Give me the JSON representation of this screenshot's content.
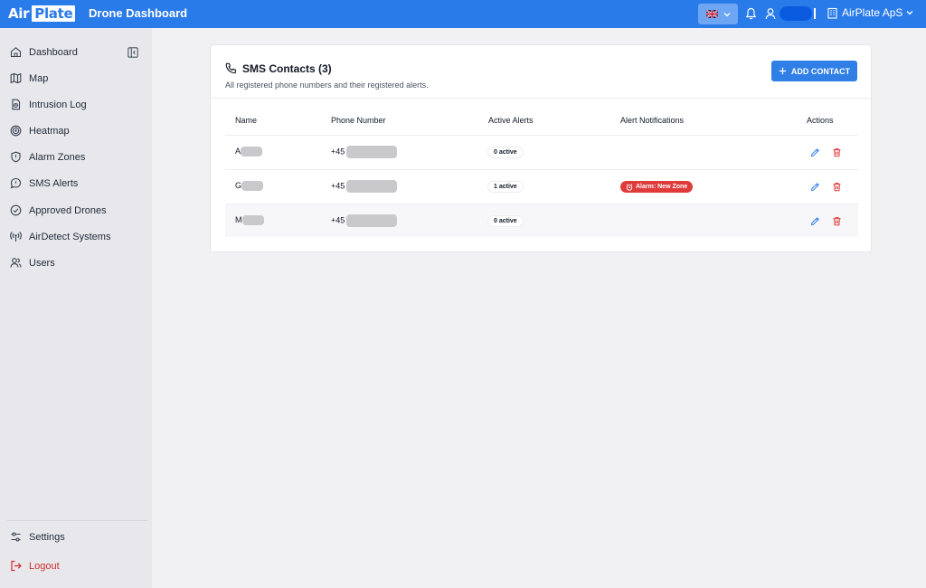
{
  "header": {
    "logo_air": "Air",
    "logo_plate": "Plate",
    "app_title": "Drone Dashboard",
    "organization": "AirPlate ApS"
  },
  "sidebar": {
    "items": [
      {
        "label": "Dashboard",
        "icon": "home-icon"
      },
      {
        "label": "Map",
        "icon": "map-icon"
      },
      {
        "label": "Intrusion Log",
        "icon": "log-icon"
      },
      {
        "label": "Heatmap",
        "icon": "target-icon"
      },
      {
        "label": "Alarm Zones",
        "icon": "shield-icon"
      },
      {
        "label": "SMS Alerts",
        "icon": "message-icon"
      },
      {
        "label": "Approved Drones",
        "icon": "check-circle-icon"
      },
      {
        "label": "AirDetect Systems",
        "icon": "antenna-icon"
      },
      {
        "label": "Users",
        "icon": "users-icon"
      }
    ],
    "settings_label": "Settings",
    "logout_label": "Logout"
  },
  "card": {
    "title": "SMS Contacts (3)",
    "subtitle": "All registered phone numbers and their registered alerts.",
    "add_button_label": "ADD CONTACT",
    "columns": [
      "Name",
      "Phone Number",
      "Active Alerts",
      "Alert Notifications",
      "Actions"
    ],
    "rows": [
      {
        "name_initial": "A",
        "phone_prefix": "+45",
        "active_alerts": "0 active",
        "notification": ""
      },
      {
        "name_initial": "G",
        "phone_prefix": "+45",
        "active_alerts": "1 active",
        "notification": "Alarm: New Zone"
      },
      {
        "name_initial": "M",
        "phone_prefix": "+45",
        "active_alerts": "0 active",
        "notification": ""
      }
    ]
  },
  "colors": {
    "brand_blue": "#2a7bea",
    "alarm_red": "#e03b3b",
    "logout_red": "#d12c2c",
    "edit_blue": "#2f7fe6"
  }
}
